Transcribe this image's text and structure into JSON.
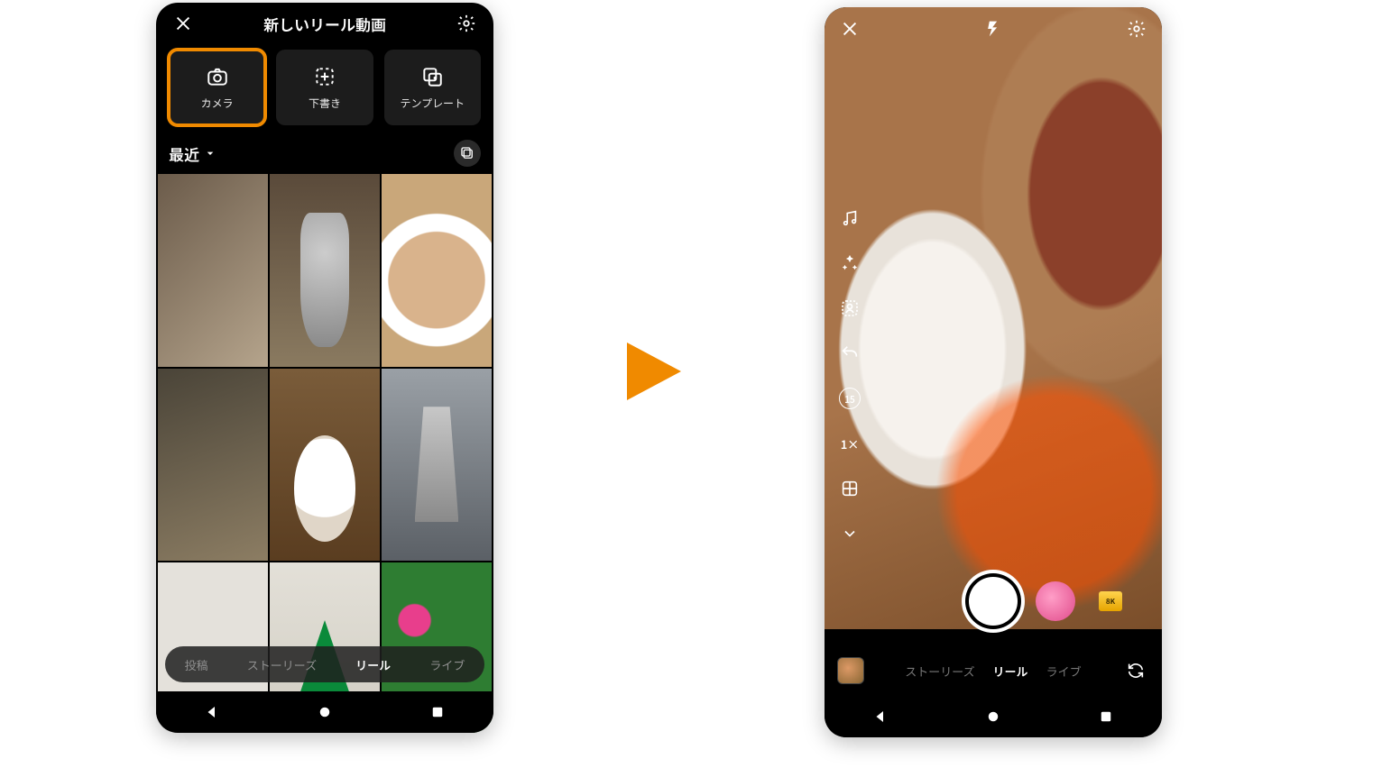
{
  "leftPhone": {
    "title": "新しいリール動画",
    "tools": {
      "camera": "カメラ",
      "drafts": "下書き",
      "templates": "テンプレート"
    },
    "albumLabel": "最近",
    "modes": {
      "post": "投稿",
      "stories": "ストーリーズ",
      "reels": "リール",
      "live": "ライブ"
    }
  },
  "rightPhone": {
    "sideTools": {
      "timer": "15",
      "zoom": "1×"
    },
    "hdBadge": "8K",
    "modes": {
      "stories": "ストーリーズ",
      "reels": "リール",
      "live": "ライブ"
    }
  }
}
